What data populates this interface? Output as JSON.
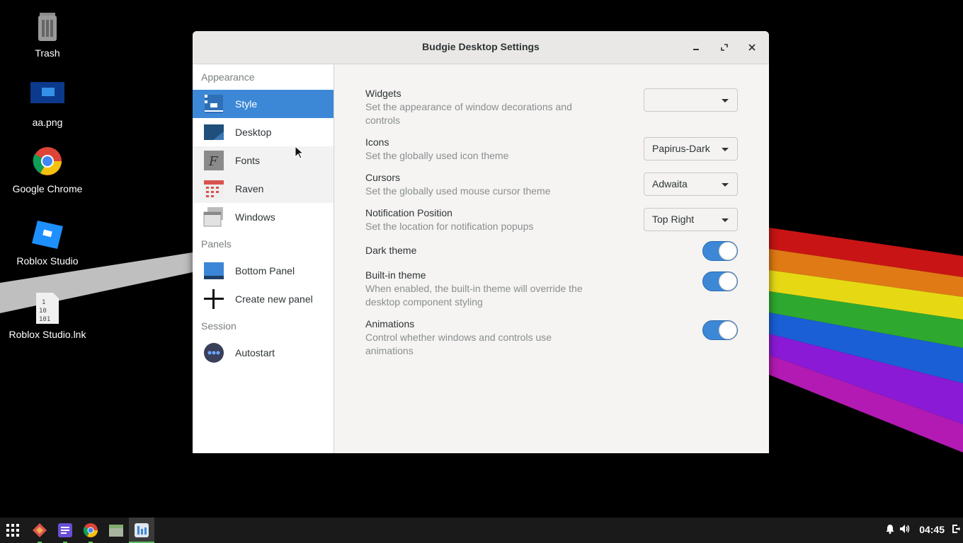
{
  "desktop": {
    "icons": [
      {
        "label": "Trash"
      },
      {
        "label": "aa.png"
      },
      {
        "label": "Google Chrome"
      },
      {
        "label": "Roblox Studio"
      },
      {
        "label": "Roblox Studio.lnk"
      }
    ]
  },
  "window": {
    "title": "Budgie Desktop Settings",
    "sidebar": {
      "sections": [
        {
          "title": "Appearance"
        },
        {
          "title": "Panels"
        },
        {
          "title": "Session"
        }
      ],
      "items": [
        {
          "label": "Style",
          "icon": "style-icon"
        },
        {
          "label": "Desktop",
          "icon": "desktop-icon"
        },
        {
          "label": "Fonts",
          "icon": "fonts-icon"
        },
        {
          "label": "Raven",
          "icon": "raven-icon"
        },
        {
          "label": "Windows",
          "icon": "windows-icon"
        },
        {
          "label": "Bottom Panel",
          "icon": "panel-icon"
        },
        {
          "label": "Create new panel",
          "icon": "plus-icon"
        },
        {
          "label": "Autostart",
          "icon": "autostart-icon"
        }
      ],
      "selected": "Style"
    },
    "settings": {
      "widgets": {
        "name": "Widgets",
        "desc": "Set the appearance of window decorations and controls",
        "value": ""
      },
      "icons": {
        "name": "Icons",
        "desc": "Set the globally used icon theme",
        "value": "Papirus-Dark"
      },
      "cursors": {
        "name": "Cursors",
        "desc": "Set the globally used mouse cursor theme",
        "value": "Adwaita"
      },
      "notification": {
        "name": "Notification Position",
        "desc": "Set the location for notification popups",
        "value": "Top Right"
      },
      "dark_theme": {
        "name": "Dark theme",
        "on": true
      },
      "builtin_theme": {
        "name": "Built-in theme",
        "desc": "When enabled, the built-in theme will override the desktop component styling",
        "on": true
      },
      "animations": {
        "name": "Animations",
        "desc": "Control whether windows and controls use animations",
        "on": true
      }
    }
  },
  "taskbar": {
    "clock": "04:45"
  },
  "colors": {
    "accent": "#3d88d6",
    "taskbar": "#1a1a1a"
  }
}
